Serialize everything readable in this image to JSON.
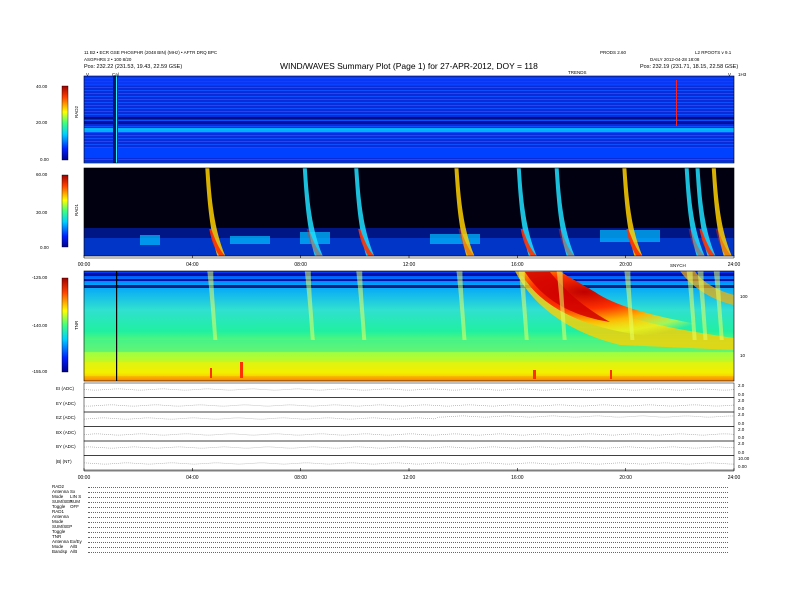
{
  "header": {
    "left_line1": "11 B2 • ECR GSE PHOSPHR (2048 BIN) (MHz) • AFTR DRQ BPC",
    "left_line2": "ASGPHRS 2 • 100 8/20",
    "left_pos": "Pos:  232.22 (231.53, 19.43, 22.59 GSE)",
    "title": "WIND/WAVES Summary Plot (Page 1) for 27-APR-2012, DOY = 118",
    "right_top_a": "PRODS 2.60",
    "right_top_b": "L2 RPOOTS v 9.1",
    "right_line2": "DAILY  2012-04-28 18:08",
    "right_pos": "Pos:  232.19 (231.71, 18.15, 22.58 GSE)",
    "marker_cal": "Cal",
    "marker_left_v": "V",
    "marker_trend": "TRENDS",
    "marker_right_v": "V",
    "marker_ts": "1H3",
    "marker_synch": "SNYCH"
  },
  "panels": {
    "rad2": {
      "label": "RAD2",
      "ticks": [
        "40.00",
        "20.00",
        "0.00"
      ]
    },
    "rad1": {
      "label": "RAD1",
      "ticks": [
        "60.00",
        "30.00",
        "0.00"
      ]
    },
    "tnr": {
      "label": "TNR",
      "ticks": [
        "-125.00",
        "-140.00",
        "-155.00"
      ],
      "right_ticks": [
        "100",
        "10"
      ]
    }
  },
  "time_axis": {
    "top": [
      "00:00",
      "04:00",
      "08:00",
      "12:00",
      "16:00",
      "20:00",
      "24:00"
    ],
    "bottom": [
      "00:00",
      "04:00",
      "08:00",
      "12:00",
      "16:00",
      "20:00",
      "24:00"
    ]
  },
  "chart_data": {
    "type": "heatmap",
    "title": "WIND/WAVES Summary Plot (Page 1) for 27-APR-2012, DOY = 118",
    "x_range": [
      "00:00",
      "24:00"
    ],
    "type_iii_bursts_hours": [
      4.7,
      8.3,
      10.2,
      13.9,
      16.2,
      17.6,
      20.1,
      22.4,
      22.8,
      23.4
    ],
    "type_ii_burst": {
      "start_hour": 16.2,
      "end_hour": 24.0,
      "panel": "TNR"
    },
    "series": [
      {
        "name": "TNR",
        "ylim": [
          -155,
          -125
        ]
      },
      {
        "name": "RAD1",
        "ylim": [
          0,
          60
        ]
      },
      {
        "name": "RAD2",
        "ylim": [
          0,
          40
        ]
      }
    ]
  },
  "line_panels": [
    {
      "label": "EI (ADC)",
      "ticks": [
        "2.0",
        "0.0"
      ]
    },
    {
      "label": "EY (ADC)",
      "ticks": [
        "2.0",
        "0.0"
      ]
    },
    {
      "label": "EZ (ADC)",
      "ticks": [
        "2.0",
        "0.0"
      ]
    },
    {
      "label": "BX (ADC)",
      "ticks": [
        "2.0",
        "0.0"
      ]
    },
    {
      "label": "BY (ADC)",
      "ticks": [
        "2.0",
        "0.0"
      ]
    },
    {
      "label": "|B| (NT)",
      "ticks": [
        "10.00",
        "0.00"
      ]
    }
  ],
  "settings": [
    {
      "label": "RAD2",
      "value": ""
    },
    {
      "label": "Antenna",
      "value": "Sx"
    },
    {
      "label": "Mode",
      "value": "LIN S"
    },
    {
      "label": "SUM/SEP",
      "value": "SUM"
    },
    {
      "label": "Toggle",
      "value": "OFF"
    },
    {
      "label": "RAD1",
      "value": ""
    },
    {
      "label": "Antenna",
      "value": ""
    },
    {
      "label": "Mode",
      "value": ""
    },
    {
      "label": "SUM/SEP",
      "value": ""
    },
    {
      "label": "Toggle",
      "value": ""
    },
    {
      "label": "TNR",
      "value": ""
    },
    {
      "label": "Antenna",
      "value": "Ex/Ey"
    },
    {
      "label": "Mode",
      "value": "A/B"
    },
    {
      "label": "Bandsp",
      "value": "A/B"
    }
  ]
}
